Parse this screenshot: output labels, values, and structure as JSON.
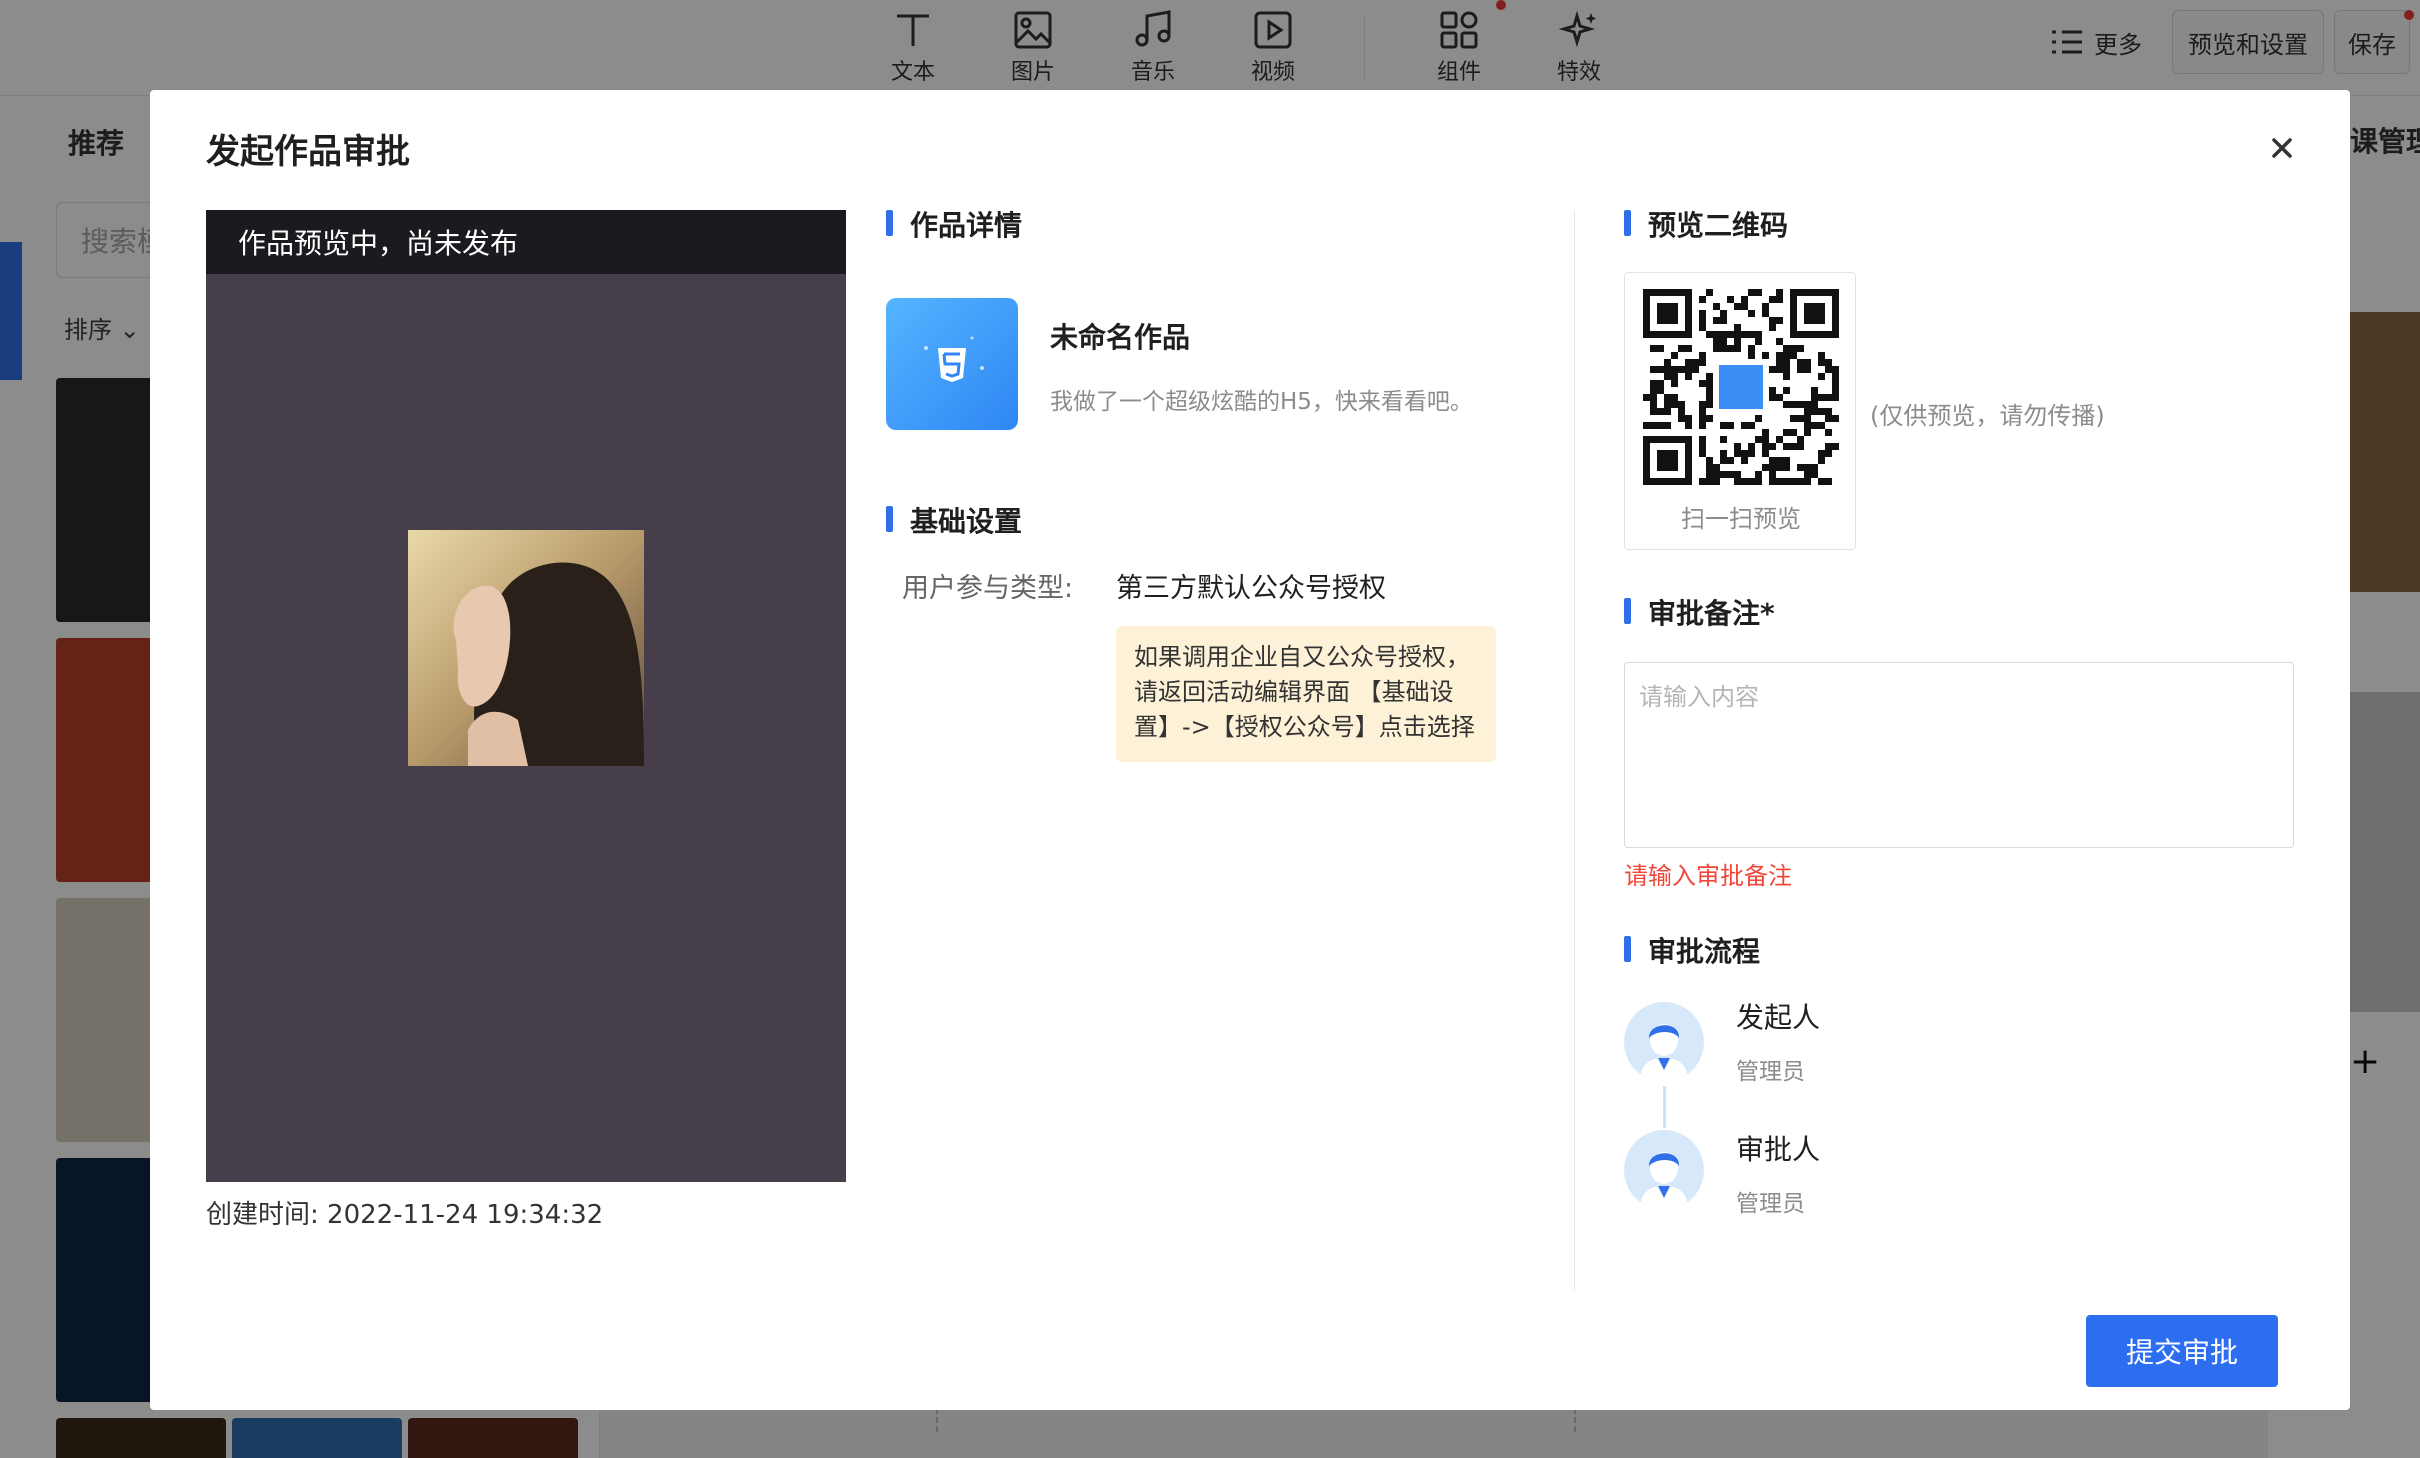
{
  "toolbar": {
    "items": [
      {
        "label": "文本",
        "icon": "text-icon"
      },
      {
        "label": "图片",
        "icon": "image-icon"
      },
      {
        "label": "音乐",
        "icon": "music-icon"
      },
      {
        "label": "视频",
        "icon": "video-icon"
      },
      {
        "label": "组件",
        "icon": "components-icon"
      },
      {
        "label": "特效",
        "icon": "sparkle-icon"
      }
    ],
    "more_label": "更多",
    "preview_settings_label": "预览和设置",
    "save_label": "保存"
  },
  "left_panel": {
    "tab_label": "推荐",
    "search_placeholder": "搜索模",
    "sort_label": "排序"
  },
  "right_panel": {
    "tab_label": "课管理"
  },
  "modal": {
    "title": "发起作品审批",
    "preview": {
      "banner": "作品预览中，尚未发布",
      "created_label": "创建时间:",
      "created_value": "2022-11-24 19:34:32"
    },
    "details": {
      "section_title": "作品详情",
      "work_name": "未命名作品",
      "work_desc": "我做了一个超级炫酷的H5，快来看看吧。"
    },
    "basic": {
      "section_title": "基础设置",
      "participation_label": "用户参与类型:",
      "participation_value": "第三方默认公众号授权",
      "tip": "如果调用企业自又公众号授权，请返回活动编辑界面 【基础设置】->【授权公众号】点击选择"
    },
    "qr": {
      "section_title": "预览二维码",
      "caption": "扫一扫预览",
      "note": "(仅供预览，请勿传播)"
    },
    "remark": {
      "section_title": "审批备注",
      "required_mark": "*",
      "placeholder": "请输入内容",
      "value": "",
      "error": "请输入审批备注"
    },
    "flow": {
      "section_title": "审批流程",
      "steps": [
        {
          "role": "发起人",
          "person": "管理员"
        },
        {
          "role": "审批人",
          "person": "管理员"
        }
      ]
    },
    "submit_label": "提交审批"
  },
  "colors": {
    "accent": "#2d6ef0",
    "error": "#f0473a",
    "tip_bg": "#fdf2d8",
    "preview_bg": "#463f4b"
  }
}
